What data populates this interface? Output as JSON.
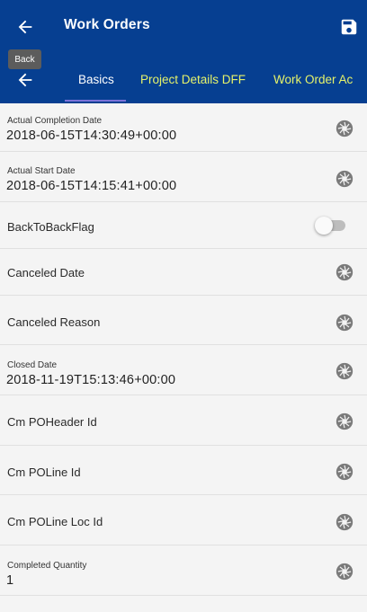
{
  "colors": {
    "header_bg": "#063f91",
    "inactive_tab": "#e5f26a",
    "tab_indicator": "#7c72d8",
    "list_bg": "#f4f4f4"
  },
  "header": {
    "title": "Work Orders",
    "back_icon": "arrow-left-icon",
    "save_icon": "floppy-disk-icon",
    "tooltip": "Back"
  },
  "tabs": [
    {
      "label": "Basics",
      "active": true
    },
    {
      "label": "Project Details DFF",
      "active": false
    },
    {
      "label": "Work Order Ac",
      "active": false
    }
  ],
  "fields": [
    {
      "label": "Actual Completion Date",
      "value": "2018-06-15T14:30:49+00:00",
      "icon": "camera-shutter-icon"
    },
    {
      "label": "Actual Start Date",
      "value": "2018-06-15T14:15:41+00:00",
      "icon": "camera-shutter-icon"
    },
    {
      "label": "BackToBackFlag",
      "toggle": false
    },
    {
      "label": "Canceled Date",
      "icon": "camera-shutter-icon"
    },
    {
      "label": "Canceled Reason",
      "icon": "camera-shutter-icon"
    },
    {
      "label": "Closed Date",
      "value": "2018-11-19T15:13:46+00:00",
      "icon": "camera-shutter-icon"
    },
    {
      "label": "Cm POHeader Id",
      "icon": "camera-shutter-icon"
    },
    {
      "label": "Cm POLine Id",
      "icon": "camera-shutter-icon"
    },
    {
      "label": "Cm POLine Loc Id",
      "icon": "camera-shutter-icon"
    },
    {
      "label": "Completed Quantity",
      "value": "1",
      "icon": "camera-shutter-icon"
    }
  ]
}
